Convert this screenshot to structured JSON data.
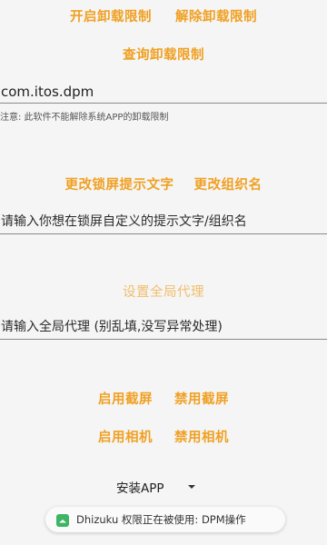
{
  "uninstall_controls": {
    "enable_label": "开启卸载限制",
    "disable_label": "解除卸载限制",
    "query_label": "查询卸载限制",
    "package_value": "com.itos.dpm",
    "note": "注意: 此软件不能解除系统APP的卸载限制"
  },
  "lockscreen_controls": {
    "change_text_label": "更改锁屏提示文字",
    "change_org_label": "更改组织名",
    "input_placeholder": "请输入你想在锁屏自定义的提示文字/组织名"
  },
  "proxy_controls": {
    "set_label": "设置全局代理",
    "input_placeholder": "请输入全局代理 (别乱填,没写异常处理)"
  },
  "capture_controls": {
    "enable_screenshot": "启用截屏",
    "disable_screenshot": "禁用截屏",
    "enable_camera": "启用相机",
    "disable_camera": "禁用相机"
  },
  "install_dropdown": {
    "selected": "安装APP"
  },
  "toast": {
    "text": "Dhizuku 权限正在被使用: DPM操作"
  },
  "colors": {
    "accent": "#f0a022",
    "accent_disabled": "#f2bd6c",
    "toast_icon": "#3db565"
  }
}
